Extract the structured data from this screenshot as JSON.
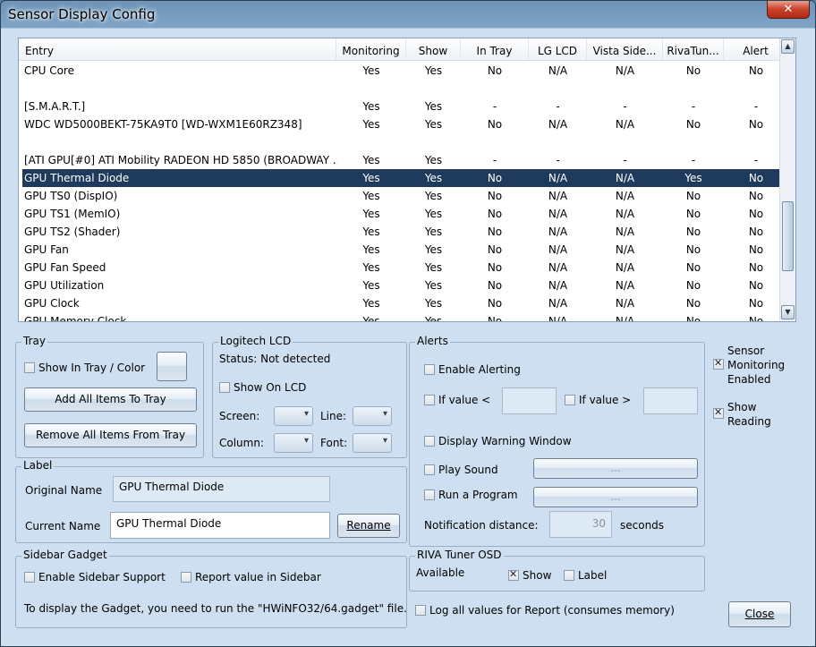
{
  "window": {
    "title": "Sensor Display Config",
    "close_glyph": "✕"
  },
  "columns": [
    "Entry",
    "Monitoring",
    "Show",
    "In Tray",
    "LG LCD",
    "Vista Side...",
    "RivaTun...",
    "Alert"
  ],
  "rows": [
    [
      "CPU Core",
      "Yes",
      "Yes",
      "No",
      "N/A",
      "N/A",
      "No",
      "No"
    ],
    [
      "",
      "",
      "",
      "",
      "",
      "",
      "",
      ""
    ],
    [
      "[S.M.A.R.T.]",
      "Yes",
      "Yes",
      "-",
      "-",
      "-",
      "-",
      "-"
    ],
    [
      "WDC WD5000BEKT-75KA9T0 [WD-WXM1E60RZ348]",
      "Yes",
      "Yes",
      "No",
      "N/A",
      "N/A",
      "No",
      "No"
    ],
    [
      "",
      "",
      "",
      "",
      "",
      "",
      "",
      ""
    ],
    [
      "[ATI GPU[#0] ATI Mobility RADEON HD 5850 (BROADWAY ...",
      "Yes",
      "Yes",
      "-",
      "-",
      "-",
      "-",
      "-"
    ],
    [
      "GPU Thermal Diode",
      "Yes",
      "Yes",
      "No",
      "N/A",
      "N/A",
      "Yes",
      "No"
    ],
    [
      "GPU TS0 (DispIO)",
      "Yes",
      "Yes",
      "No",
      "N/A",
      "N/A",
      "No",
      "No"
    ],
    [
      "GPU TS1 (MemIO)",
      "Yes",
      "Yes",
      "No",
      "N/A",
      "N/A",
      "No",
      "No"
    ],
    [
      "GPU TS2 (Shader)",
      "Yes",
      "Yes",
      "No",
      "N/A",
      "N/A",
      "No",
      "No"
    ],
    [
      "GPU Fan",
      "Yes",
      "Yes",
      "No",
      "N/A",
      "N/A",
      "No",
      "No"
    ],
    [
      "GPU Fan Speed",
      "Yes",
      "Yes",
      "No",
      "N/A",
      "N/A",
      "No",
      "No"
    ],
    [
      "GPU Utilization",
      "Yes",
      "Yes",
      "No",
      "N/A",
      "N/A",
      "No",
      "No"
    ],
    [
      "GPU Clock",
      "Yes",
      "Yes",
      "No",
      "N/A",
      "N/A",
      "No",
      "No"
    ],
    [
      "GPU Memory Clock",
      "Yes",
      "Yes",
      "No",
      "N/A",
      "N/A",
      "No",
      "No"
    ]
  ],
  "selected_row": 6,
  "tray": {
    "title": "Tray",
    "show_label": "Show In Tray / Color",
    "add_all": "Add All Items To Tray",
    "remove_all": "Remove All Items From Tray"
  },
  "logitech": {
    "title": "Logitech LCD",
    "status": "Status: Not detected",
    "show_on_lcd": "Show On LCD",
    "screen": "Screen:",
    "line": "Line:",
    "column": "Column:",
    "font": "Font:"
  },
  "alerts": {
    "title": "Alerts",
    "enable": "Enable Alerting",
    "if_lt": "If value <",
    "if_gt": "If value >",
    "warning": "Display Warning Window",
    "play_sound": "Play Sound",
    "run_program": "Run a Program",
    "browse": "...",
    "notif_label": "Notification distance:",
    "notif_value": "30",
    "seconds": "seconds"
  },
  "right": {
    "sensor_monitoring": "Sensor Monitoring Enabled",
    "show_reading": "Show Reading"
  },
  "label": {
    "title": "Label",
    "original_label": "Original Name",
    "original_value": "GPU Thermal Diode",
    "current_label": "Current Name",
    "current_value": "GPU Thermal Diode",
    "rename": "Rename"
  },
  "sidebar": {
    "title": "Sidebar Gadget",
    "enable": "Enable Sidebar Support",
    "report": "Report value in Sidebar",
    "note": "To display the Gadget, you need to run the \"HWiNFO32/64.gadget\" file."
  },
  "riva": {
    "title": "RIVA Tuner OSD",
    "available": "Available",
    "show": "Show",
    "label": "Label"
  },
  "log_all": "Log all values for Report (consumes memory)",
  "close_button": "Close"
}
